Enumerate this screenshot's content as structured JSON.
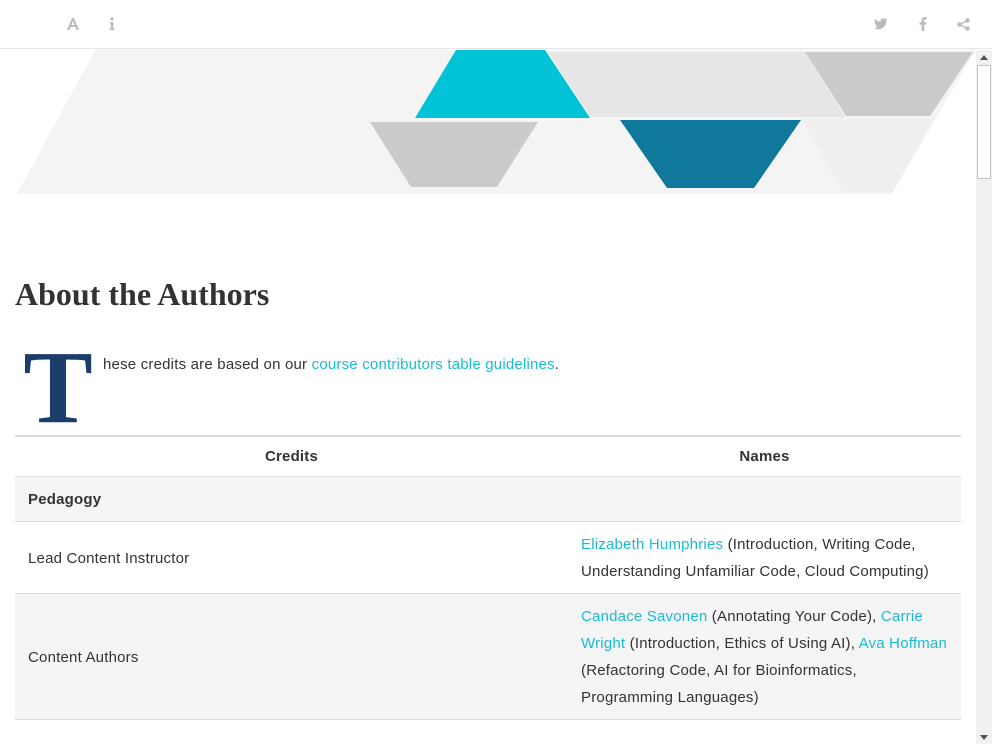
{
  "toolbar": {
    "left_icons": [
      "font-settings-icon",
      "info-icon"
    ],
    "right_icons": [
      "twitter-icon",
      "facebook-icon",
      "share-icon"
    ],
    "icon_color": "#bbbbbb"
  },
  "banner": {
    "colors": {
      "background": "#f4f4f4",
      "light_gray": "#e6e6e6",
      "mid_gray": "#cbcbcb",
      "cyan": "#00c3d8",
      "teal": "#10799b"
    }
  },
  "page": {
    "title": "About the Authors",
    "drop_cap": "T",
    "intro_before_link": "hese credits are based on our ",
    "intro_link": "course contributors table guidelines",
    "intro_after_link": ".",
    "accent_color": "#18bdd3",
    "dropcap_color": "#1a3d6a"
  },
  "table": {
    "headers": [
      "Credits",
      "Names"
    ],
    "rows": [
      {
        "credit": "Pedagogy",
        "section": true
      },
      {
        "credit": "Lead Content Instructor",
        "names": [
          {
            "text": "Elizabeth Humphries",
            "link": true
          },
          {
            "text": " (Introduction, Writing Code, Understanding Unfamiliar Code, Cloud Computing)",
            "link": false
          }
        ]
      },
      {
        "credit": "Content Authors",
        "names": [
          {
            "text": "Candace Savonen",
            "link": true
          },
          {
            "text": " (Annotating Your Code), ",
            "link": false
          },
          {
            "text": "Carrie Wright",
            "link": true
          },
          {
            "text": " (Introduction, Ethics of Using AI), ",
            "link": false
          },
          {
            "text": "Ava Hoffman",
            "link": true
          },
          {
            "text": " (Refactoring Code, AI for Bioinformatics, Programming Languages)",
            "link": false
          }
        ]
      }
    ]
  }
}
